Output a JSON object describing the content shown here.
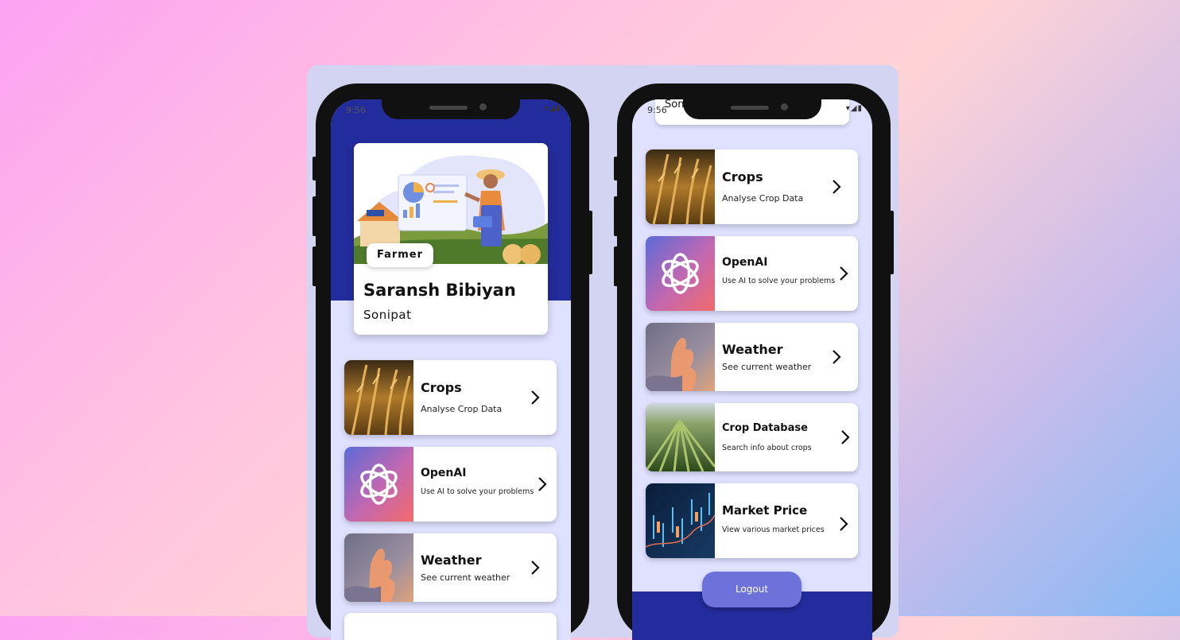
{
  "left_phone": {
    "status_time": "9:56",
    "profile": {
      "role": "Farmer",
      "name": "Saransh Bibiyan",
      "location": "Sonipat"
    },
    "cards": [
      {
        "title": "Crops",
        "subtitle": "Analyse Crop Data"
      },
      {
        "title": "OpenAI",
        "subtitle": "Use AI to solve your problems"
      },
      {
        "title": "Weather",
        "subtitle": "See current weather"
      }
    ]
  },
  "right_phone": {
    "status_time": "9:56",
    "peek_text": "Son",
    "cards": [
      {
        "title": "Crops",
        "subtitle": "Analyse Crop Data"
      },
      {
        "title": "OpenAI",
        "subtitle": "Use AI to solve your problems"
      },
      {
        "title": "Weather",
        "subtitle": "See current weather"
      },
      {
        "title": "Crop Database",
        "subtitle": "Search info about crops"
      },
      {
        "title": "Market Price",
        "subtitle": "View various market prices"
      }
    ],
    "logout_label": "Logout"
  },
  "icons": {
    "status": [
      "notification-icon",
      "wifi-icon",
      "signal-icon",
      "battery-icon"
    ],
    "chevron": "chevron-right-icon",
    "openai": "openai-logo-icon"
  },
  "colors": {
    "header_blue": "#232c9c",
    "screen_bg": "#dfe1ff",
    "logout_button": "#6d72da"
  }
}
